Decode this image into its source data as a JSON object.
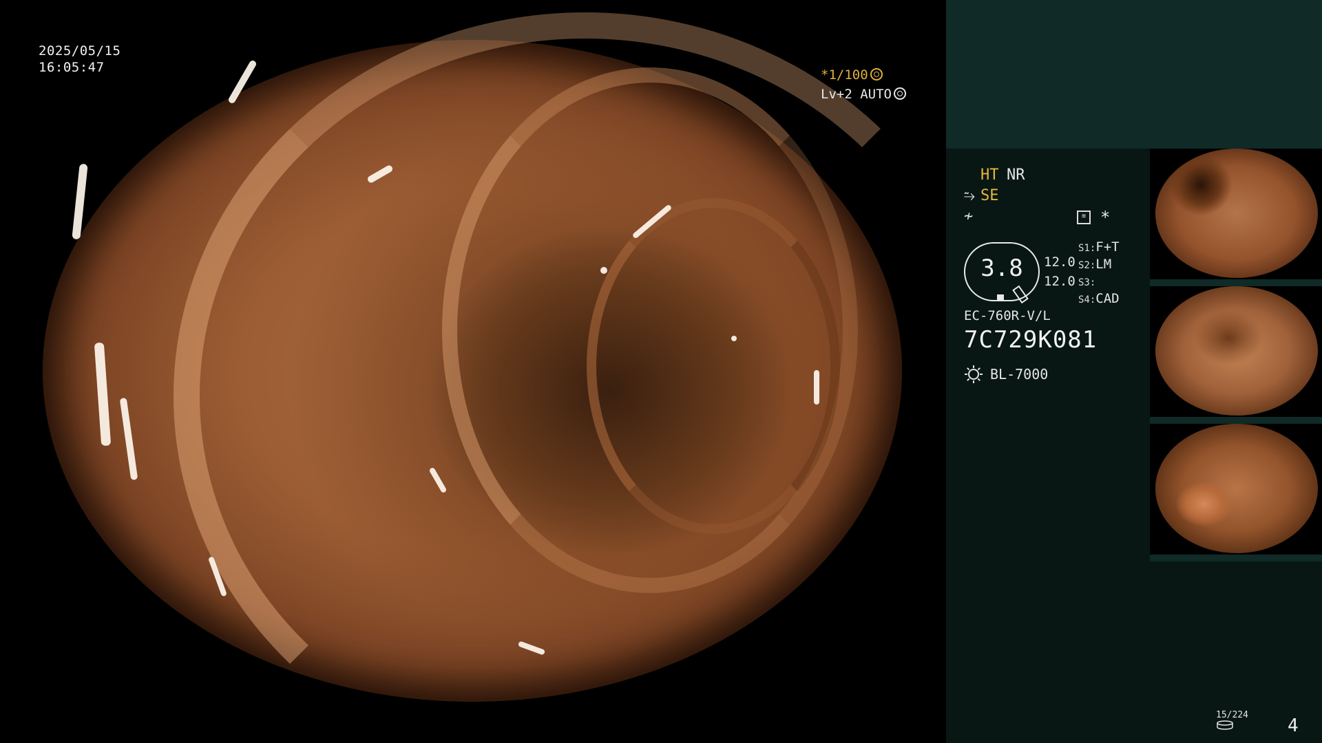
{
  "view": {
    "date": "2025/05/15",
    "time": "16:05:47",
    "shutter": "*1/100",
    "level": "Lv+2 AUTO"
  },
  "panel": {
    "ht_label": "HT",
    "nr_label": "NR",
    "se_label": "SE",
    "f_icon": "signal-wave-icon",
    "star": "*",
    "gauge_value": "3.8",
    "value_1": "12.0",
    "value_2": "12.0",
    "switches": [
      {
        "label": "S1",
        "value": "F+T"
      },
      {
        "label": "S2",
        "value": "LM"
      },
      {
        "label": "S3",
        "value": ""
      },
      {
        "label": "S4",
        "value": "CAD"
      }
    ],
    "scope_model": "EC-760R-V/L",
    "scope_serial": "7C729K081",
    "light_source": "BL-7000",
    "image_count": "15/224",
    "page_number": "4",
    "accent_yellow": "#e8b63c",
    "panel_bg": "#081714",
    "panel_top_bg": "#0f2a27"
  }
}
